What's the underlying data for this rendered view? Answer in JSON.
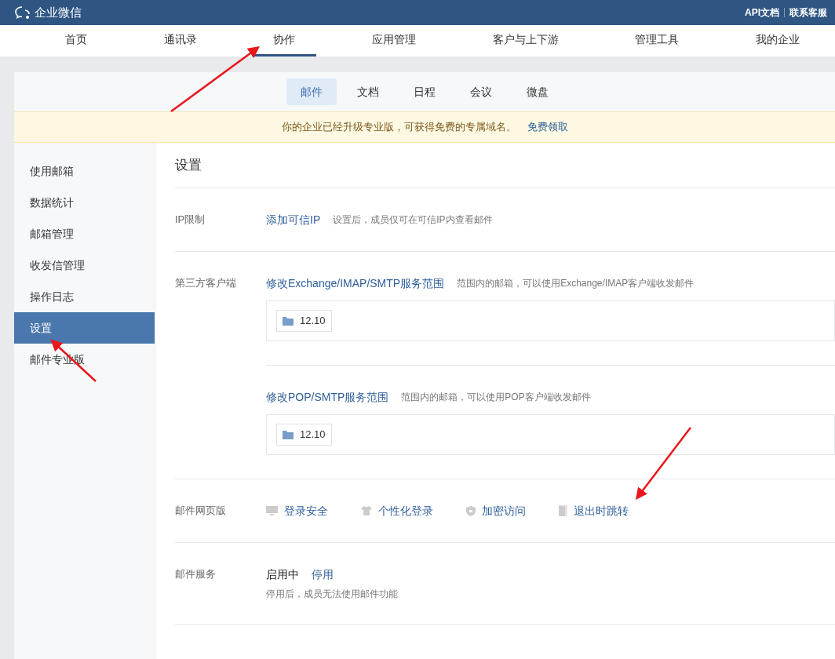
{
  "header": {
    "title": "企业微信",
    "links": [
      "API文档",
      "联系客服"
    ]
  },
  "nav": [
    {
      "label": "首页",
      "selected": false
    },
    {
      "label": "通讯录",
      "selected": false
    },
    {
      "label": "协作",
      "selected": true
    },
    {
      "label": "应用管理",
      "selected": false
    },
    {
      "label": "客户与上下游",
      "selected": false
    },
    {
      "label": "管理工具",
      "selected": false
    },
    {
      "label": "我的企业",
      "selected": false
    }
  ],
  "subtabs": [
    {
      "label": "邮件",
      "selected": true
    },
    {
      "label": "文档",
      "selected": false
    },
    {
      "label": "日程",
      "selected": false
    },
    {
      "label": "会议",
      "selected": false
    },
    {
      "label": "微盘",
      "selected": false
    }
  ],
  "banner": {
    "text": "你的企业已经升级专业版，可获得免费的专属域名。",
    "link": "免费领取"
  },
  "sidebar": [
    {
      "label": "使用邮箱",
      "selected": false
    },
    {
      "label": "数据统计",
      "selected": false
    },
    {
      "label": "邮箱管理",
      "selected": false
    },
    {
      "label": "收发信管理",
      "selected": false
    },
    {
      "label": "操作日志",
      "selected": false
    },
    {
      "label": "设置",
      "selected": true
    },
    {
      "label": "邮件专业版",
      "selected": false
    }
  ],
  "page_title": "设置",
  "sections": [
    {
      "kind": "link",
      "label": "IP限制",
      "link": "添加可信IP",
      "hint": "设置后，成员仅可在可信IP内查看邮件"
    },
    {
      "kind": "scopes",
      "label": "第三方客户端",
      "scopes": [
        {
          "link": "修改Exchange/IMAP/SMTP服务范围",
          "hint": "范围内的邮箱，可以使用Exchange/IMAP客户端收发邮件",
          "folder": "12.10"
        },
        {
          "link": "修改POP/SMTP服务范围",
          "hint": "范围内的邮箱，可以使用POP客户端收发邮件",
          "folder": "12.10"
        }
      ]
    },
    {
      "kind": "actions",
      "label": "邮件网页版",
      "actions": [
        {
          "label": "登录安全"
        },
        {
          "label": "个性化登录"
        },
        {
          "label": "加密访问"
        },
        {
          "label": "退出时跳转"
        }
      ]
    },
    {
      "kind": "status",
      "label": "邮件服务",
      "status": "启用中",
      "link": "停用",
      "hint": "停用后，成员无法使用邮件功能"
    }
  ]
}
